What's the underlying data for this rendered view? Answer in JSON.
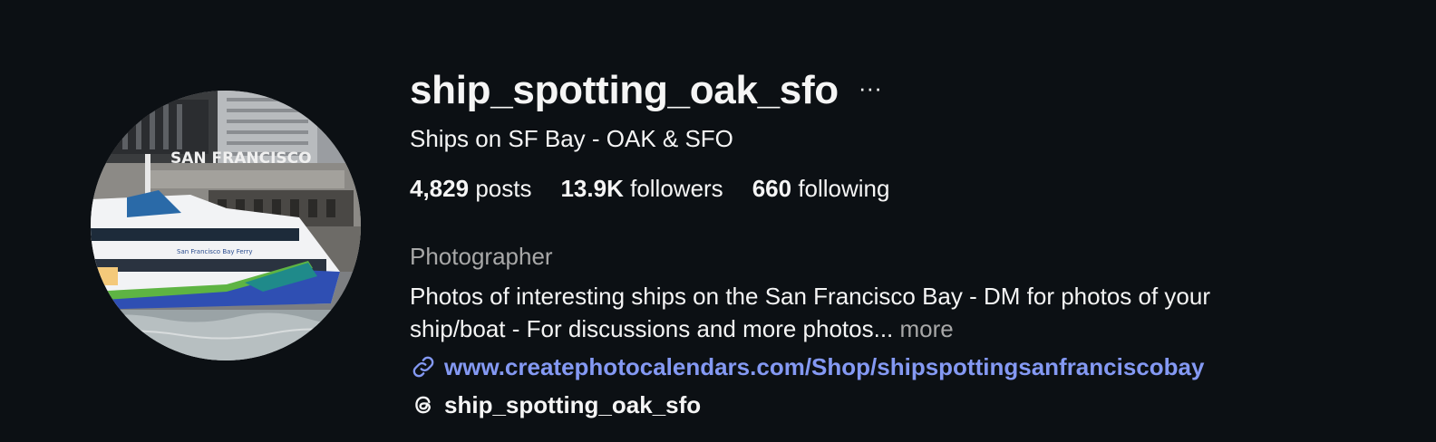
{
  "profile": {
    "username": "ship_spotting_oak_sfo",
    "more_icon": "ellipsis-icon",
    "full_name": "Ships on SF Bay - OAK & SFO",
    "avatar": {
      "alt": "ferry-photo",
      "sign_text": "SAN FRANCISCO",
      "ferry_text": "San Francisco Bay Ferry"
    },
    "stats": {
      "posts": {
        "count": "4,829",
        "label": "posts"
      },
      "followers": {
        "count": "13.9K",
        "label": "followers"
      },
      "following": {
        "count": "660",
        "label": "following"
      }
    },
    "category": "Photographer",
    "bio_line1": "Photos of interesting ships on the San Francisco Bay - DM for photos of your",
    "bio_line2": "ship/boat - For discussions and more photos...",
    "bio_more": "more",
    "website": "www.createphotocalendars.com/Shop/shipspottingsanfranciscobay",
    "website_icon": "link-icon",
    "threads_handle": "ship_spotting_oak_sfo",
    "threads_icon": "threads-icon"
  },
  "colors": {
    "background": "#0c1014",
    "text": "#f5f5f5",
    "muted": "#a8a8a8",
    "link": "#8499f3"
  }
}
